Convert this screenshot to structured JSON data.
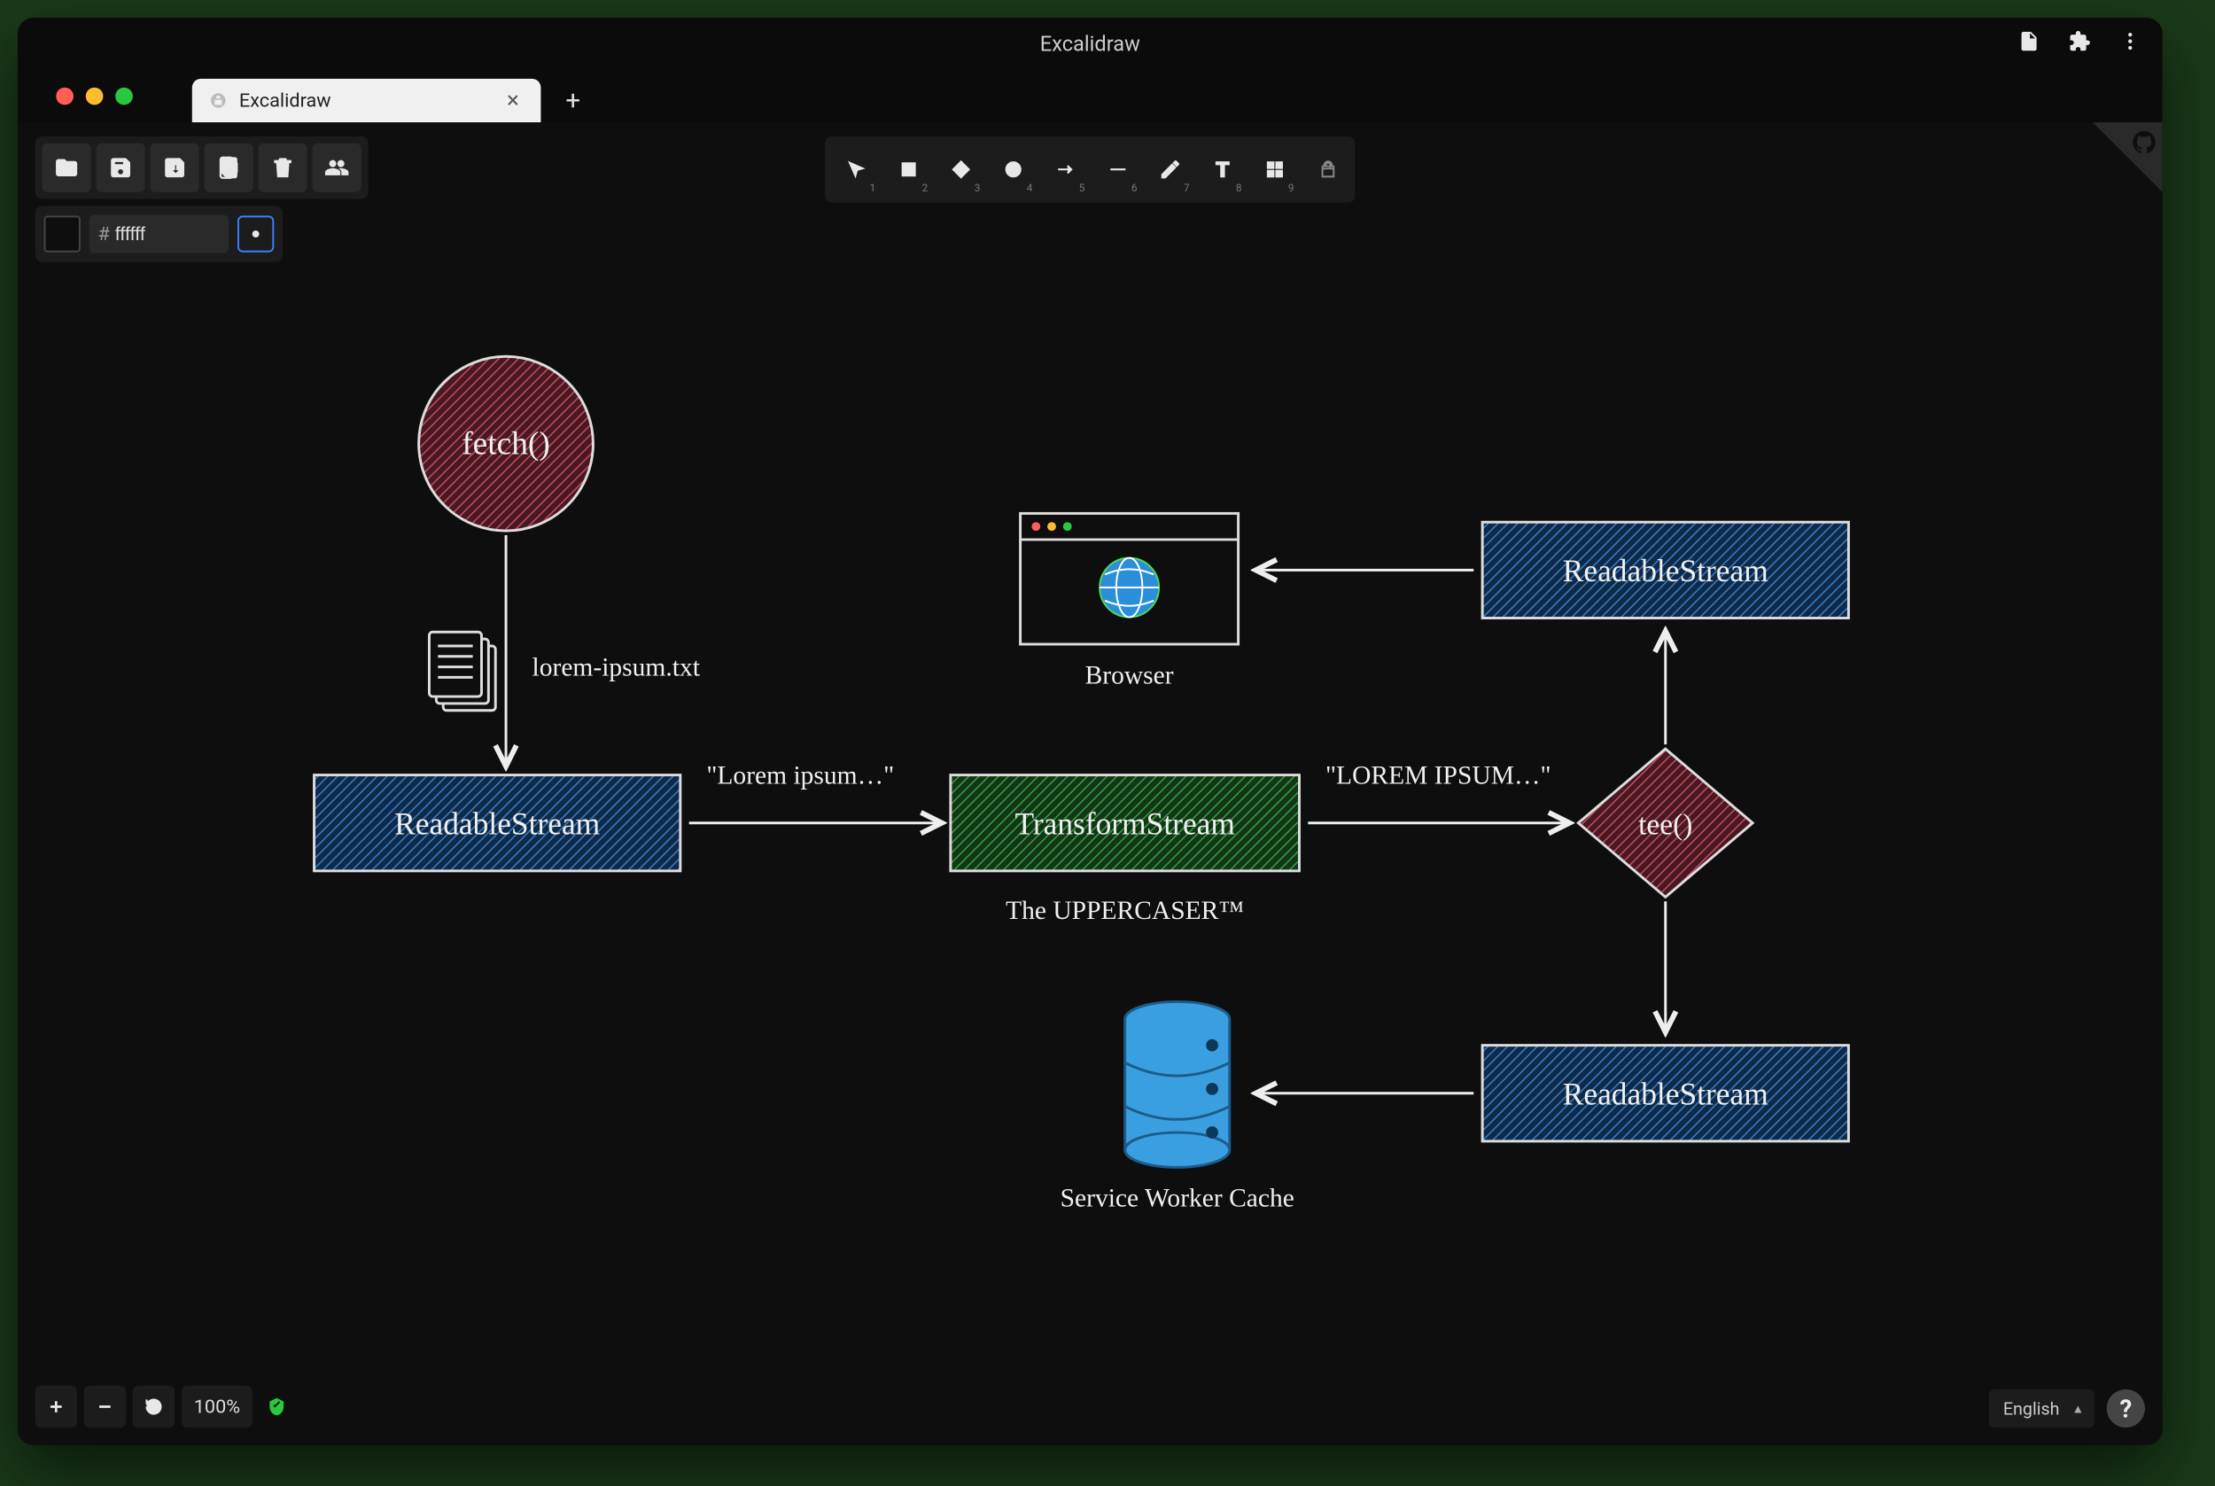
{
  "window": {
    "title": "Excalidraw"
  },
  "tab": {
    "title": "Excalidraw"
  },
  "color": {
    "hex": "ffffff",
    "hash": "#"
  },
  "tools": {
    "indices": [
      "1",
      "2",
      "3",
      "4",
      "5",
      "6",
      "7",
      "8",
      "9"
    ]
  },
  "zoom": {
    "label": "100%"
  },
  "language": {
    "selected": "English"
  },
  "diagram": {
    "fetch": "fetch()",
    "file": "lorem-ipsum.txt",
    "readable1": "ReadableStream",
    "lorem_lower": "\"Lorem ipsum…\"",
    "transform": "TransformStream",
    "uppercaser": "The UPPERCASER™",
    "lorem_upper": "\"LOREM IPSUM…\"",
    "tee": "tee()",
    "readable2": "ReadableStream",
    "browser": "Browser",
    "readable3": "ReadableStream",
    "swcache": "Service Worker Cache"
  },
  "chart_data": {
    "type": "diagram",
    "nodes": [
      {
        "id": "fetch",
        "shape": "circle",
        "label": "fetch()",
        "fill": "#6b1f2a"
      },
      {
        "id": "file",
        "shape": "icon",
        "label": "lorem-ipsum.txt",
        "icon": "document-stack"
      },
      {
        "id": "rs1",
        "shape": "rect",
        "label": "ReadableStream",
        "fill": "#163a63"
      },
      {
        "id": "ts",
        "shape": "rect",
        "label": "TransformStream",
        "fill": "#1d4f22",
        "sublabel": "The UPPERCASER™"
      },
      {
        "id": "tee",
        "shape": "diamond",
        "label": "tee()",
        "fill": "#6b1f2a"
      },
      {
        "id": "rs2",
        "shape": "rect",
        "label": "ReadableStream",
        "fill": "#163a63"
      },
      {
        "id": "browser",
        "shape": "icon",
        "label": "Browser",
        "icon": "browser-window"
      },
      {
        "id": "rs3",
        "shape": "rect",
        "label": "ReadableStream",
        "fill": "#163a63"
      },
      {
        "id": "swcache",
        "shape": "icon",
        "label": "Service Worker Cache",
        "icon": "database"
      }
    ],
    "edges": [
      {
        "from": "fetch",
        "to": "rs1",
        "sidelabel_node": "file"
      },
      {
        "from": "rs1",
        "to": "ts",
        "label": "\"Lorem ipsum…\""
      },
      {
        "from": "ts",
        "to": "tee",
        "label": "\"LOREM IPSUM…\""
      },
      {
        "from": "tee",
        "to": "rs2"
      },
      {
        "from": "rs2",
        "to": "browser"
      },
      {
        "from": "tee",
        "to": "rs3"
      },
      {
        "from": "rs3",
        "to": "swcache"
      }
    ]
  }
}
